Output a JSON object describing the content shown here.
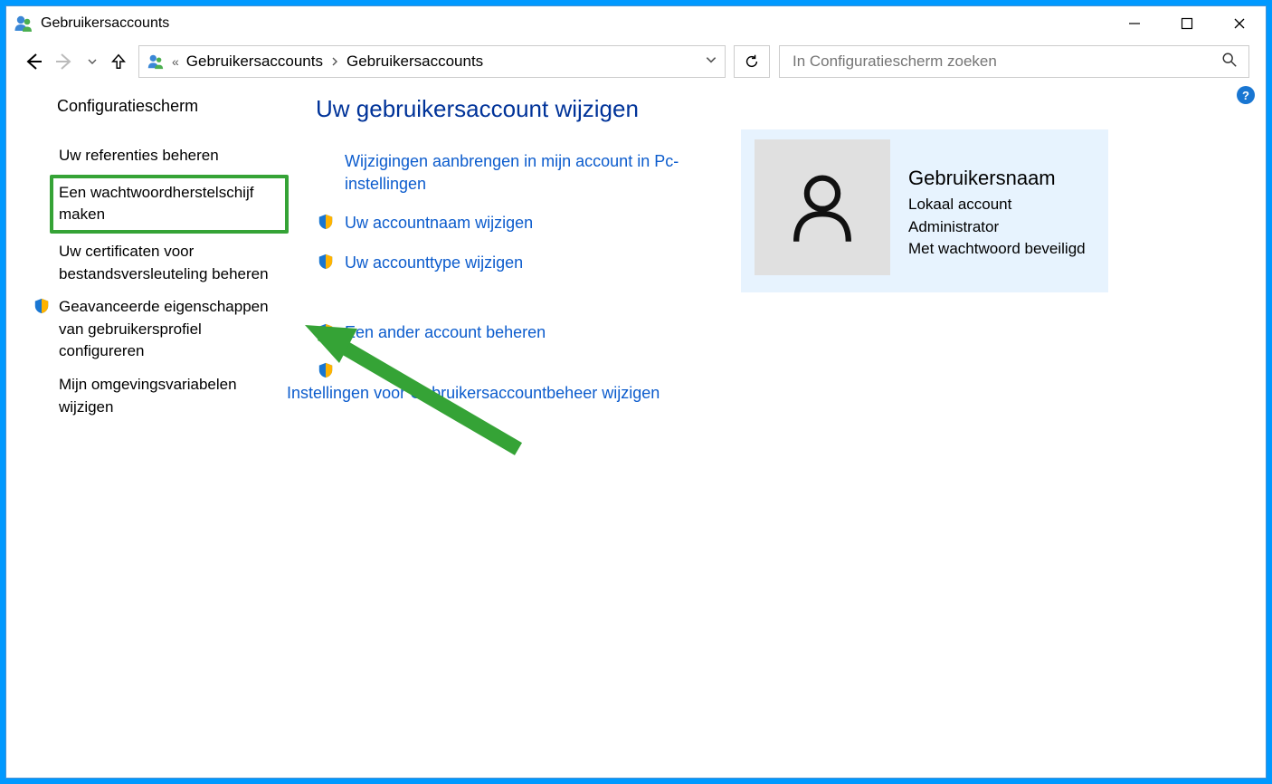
{
  "window": {
    "title": "Gebruikersaccounts"
  },
  "breadcrumb": {
    "item1": "Gebruikersaccounts",
    "item2": "Gebruikersaccounts"
  },
  "search": {
    "placeholder": "In Configuratiescherm zoeken"
  },
  "help": {
    "glyph": "?"
  },
  "sidebar": {
    "head": "Configuratiescherm",
    "items": [
      {
        "label": "Uw referenties beheren",
        "shield": false
      },
      {
        "label": "Een wachtwoordherstelschijf maken",
        "shield": false,
        "highlighted": true
      },
      {
        "label": "Uw certificaten voor bestandsversleuteling beheren",
        "shield": false
      },
      {
        "label": "Geavanceerde eigenschappen van gebruikersprofiel configureren",
        "shield": true
      },
      {
        "label": "Mijn omgevingsvariabelen wijzigen",
        "shield": false
      }
    ]
  },
  "main": {
    "heading": "Uw gebruikersaccount wijzigen",
    "actions": [
      {
        "label": "Wijzigingen aanbrengen in mijn account in Pc-instellingen",
        "shield": false
      },
      {
        "label": "Uw accountnaam wijzigen",
        "shield": true
      },
      {
        "label": "Uw accounttype wijzigen",
        "shield": true
      }
    ],
    "actions2": [
      {
        "label": "Een ander account beheren",
        "shield": true
      },
      {
        "label": "Instellingen voor Gebruikersaccountbeheer wijzigen",
        "shield": true,
        "iconOnOwnLine": true
      }
    ]
  },
  "account": {
    "name": "Gebruikersnaam",
    "line1": "Lokaal account",
    "line2": "Administrator",
    "line3": "Met wachtwoord beveiligd"
  }
}
